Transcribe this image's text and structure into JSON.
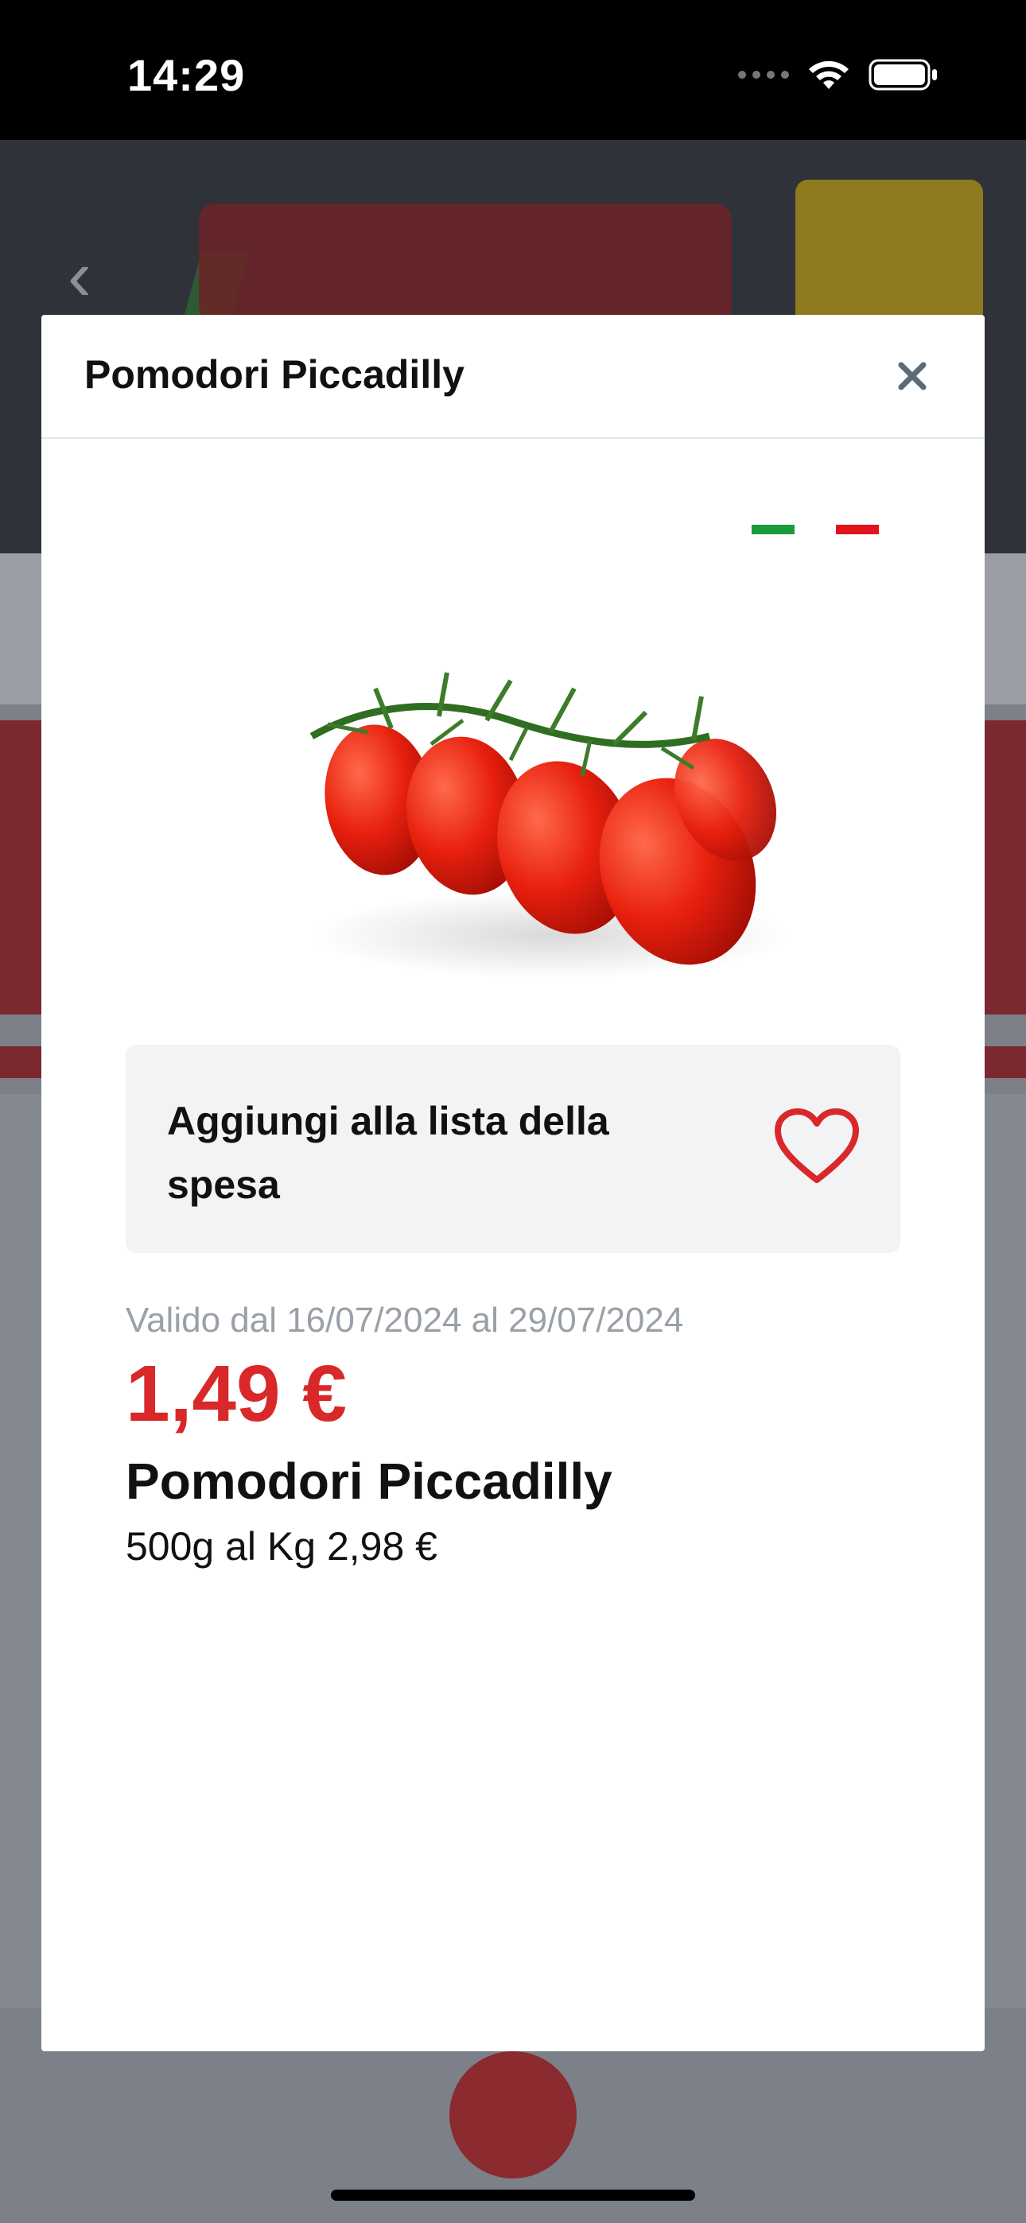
{
  "status_bar": {
    "time": "14:29"
  },
  "modal": {
    "title": "Pomodori Piccadilly",
    "flag_colors": [
      "#1a9b3c",
      "#e3131b"
    ],
    "favorite_label": "Aggiungi alla lista della spesa",
    "validity": "Valido dal 16/07/2024 al 29/07/2024",
    "price": "1,49 €",
    "product_name": "Pomodori Piccadilly",
    "product_desc": "500g al Kg 2,98 €"
  },
  "colors": {
    "accent_red": "#d8282a"
  }
}
